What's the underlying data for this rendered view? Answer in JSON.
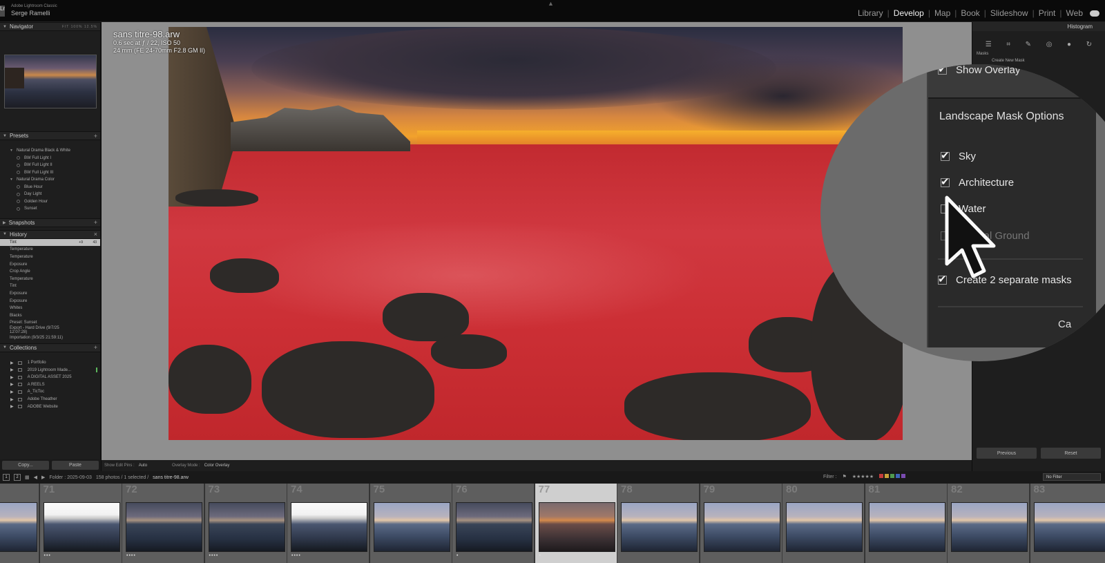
{
  "app": {
    "name": "Adobe Lightroom Classic",
    "user": "Serge Ramelli",
    "badge": "Lr"
  },
  "modules": [
    {
      "label": "Library",
      "active": false
    },
    {
      "label": "Develop",
      "active": true
    },
    {
      "label": "Map",
      "active": false
    },
    {
      "label": "Book",
      "active": false
    },
    {
      "label": "Slideshow",
      "active": false
    },
    {
      "label": "Print",
      "active": false
    },
    {
      "label": "Web",
      "active": false
    }
  ],
  "left": {
    "navigator": {
      "title": "Navigator",
      "zooms": "FIT  100%  12.5%"
    },
    "presets": {
      "title": "Presets",
      "groups": [
        {
          "name": "Natural Drama Black & White",
          "items": [
            "BW Full Light I",
            "BW Full Light II",
            "BW Full Light III"
          ]
        },
        {
          "name": "Natural Drama Color",
          "items": [
            "Blue Hour",
            "Day Light",
            "Golden Hour",
            "Sunset"
          ]
        }
      ]
    },
    "snapshots": {
      "title": "Snapshots"
    },
    "history": {
      "title": "History",
      "items": [
        {
          "label": "Tint",
          "a": "+9",
          "b": "43",
          "selected": true
        },
        {
          "label": "Temperature",
          "a": "",
          "b": "",
          "selected": false
        },
        {
          "label": "Temperature",
          "a": "",
          "b": "",
          "selected": false
        },
        {
          "label": "Exposure",
          "a": "",
          "b": "",
          "selected": false
        },
        {
          "label": "Crop Angle",
          "a": "",
          "b": "",
          "selected": false
        },
        {
          "label": "Temperature",
          "a": "",
          "b": "",
          "selected": false
        },
        {
          "label": "Tint",
          "a": "",
          "b": "",
          "selected": false
        },
        {
          "label": "Exposure",
          "a": "",
          "b": "",
          "selected": false
        },
        {
          "label": "Exposure",
          "a": "",
          "b": "",
          "selected": false
        },
        {
          "label": "Whites",
          "a": "",
          "b": "",
          "selected": false
        },
        {
          "label": "Blacks",
          "a": "",
          "b": "",
          "selected": false
        },
        {
          "label": "Preset: Sunset",
          "a": "",
          "b": "",
          "selected": false
        },
        {
          "label": "Export - Hard Drive (9/7/25 12:07:28)",
          "a": "",
          "b": "",
          "selected": false
        },
        {
          "label": "Importation (9/3/25 21:59:11)",
          "a": "",
          "b": "",
          "selected": false
        }
      ]
    },
    "collections": {
      "title": "Collections",
      "items": [
        "1 Portfolio",
        "2019 Lightroom Made...",
        "A DIGITAL ASSET 2025",
        "A REELS",
        "A_TicToc",
        "Adobe Theather",
        "ADOBE Website"
      ]
    },
    "buttons": {
      "copy": "Copy...",
      "paste": "Paste"
    }
  },
  "photo": {
    "filename": "sans titre-98.arw",
    "exposure": "0.6 sec at ƒ / 22, ISO 50",
    "lens": "24 mm (FE 24-70mm F2.8 GM II)"
  },
  "centerbar": {
    "show_edit_pins_label": "Show Edit Pins :",
    "show_edit_pins": "Auto",
    "overlay_mode_label": "Overlay Mode :",
    "overlay_mode": "Color Overlay"
  },
  "right": {
    "histogram": "Histogram",
    "masks_label": "Masks",
    "create_new_mask": "Create New Mask",
    "buttons": {
      "previous": "Previous",
      "reset": "Reset"
    }
  },
  "mask_options": {
    "show_overlay": "Show Overlay",
    "title": "Landscape Mask Options",
    "options": [
      {
        "label": "Sky",
        "checked": true,
        "enabled": true
      },
      {
        "label": "Architecture",
        "checked": true,
        "enabled": true
      },
      {
        "label": "Water",
        "checked": false,
        "enabled": true
      },
      {
        "label": "Natural Ground",
        "checked": false,
        "enabled": false
      }
    ],
    "create_separate": "Create 2 separate masks",
    "cancel": "Ca"
  },
  "filmbar": {
    "page1": "1",
    "page2": "2",
    "folder": "Folder : 2025-09-03",
    "count": "158 photos / 1 selected /",
    "current": "sans titre-98.arw",
    "filter_label": "Filter :",
    "no_filter": "No Filter",
    "label_colors": [
      "#c23b3b",
      "#c9a23a",
      "#4f9a4f",
      "#3d64b8",
      "#7a4bb0"
    ]
  },
  "filmstrip": [
    {
      "num": "",
      "stars": "",
      "style": "",
      "selected": false
    },
    {
      "num": "71",
      "stars": "•••",
      "style": "w",
      "selected": false
    },
    {
      "num": "72",
      "stars": "••••",
      "style": "d",
      "selected": false
    },
    {
      "num": "73",
      "stars": "••••",
      "style": "d",
      "selected": false
    },
    {
      "num": "74",
      "stars": "••••",
      "style": "w",
      "selected": false
    },
    {
      "num": "75",
      "stars": "",
      "style": "",
      "selected": false
    },
    {
      "num": "76",
      "stars": "•",
      "style": "d",
      "selected": false
    },
    {
      "num": "77",
      "stars": "•",
      "style": "warm",
      "selected": true
    },
    {
      "num": "78",
      "stars": "",
      "style": "",
      "selected": false
    },
    {
      "num": "79",
      "stars": "",
      "style": "",
      "selected": false
    },
    {
      "num": "80",
      "stars": "",
      "style": "",
      "selected": false
    },
    {
      "num": "81",
      "stars": "",
      "style": "",
      "selected": false
    },
    {
      "num": "82",
      "stars": "",
      "style": "",
      "selected": false
    },
    {
      "num": "83",
      "stars": "",
      "style": "",
      "selected": false
    }
  ]
}
